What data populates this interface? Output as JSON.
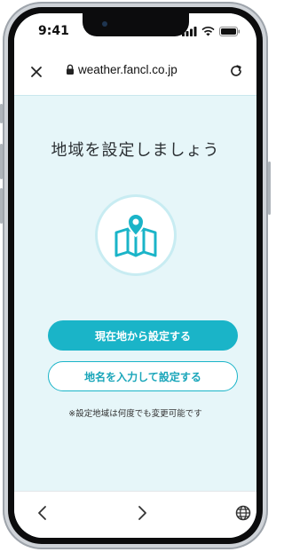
{
  "status_bar": {
    "time": "9:41"
  },
  "browser": {
    "url": "weather.fancl.co.jp"
  },
  "main": {
    "title": "地域を設定しましょう",
    "primary_button": "現在地から設定する",
    "secondary_button": "地名を入力して設定する",
    "note": "※設定地域は何度でも変更可能です"
  },
  "colors": {
    "accent": "#1ab4c8",
    "background": "#e6f6f9"
  },
  "icons": [
    "close-icon",
    "lock-icon",
    "reload-icon",
    "map-pin-icon",
    "back-icon",
    "forward-icon",
    "globe-icon"
  ]
}
